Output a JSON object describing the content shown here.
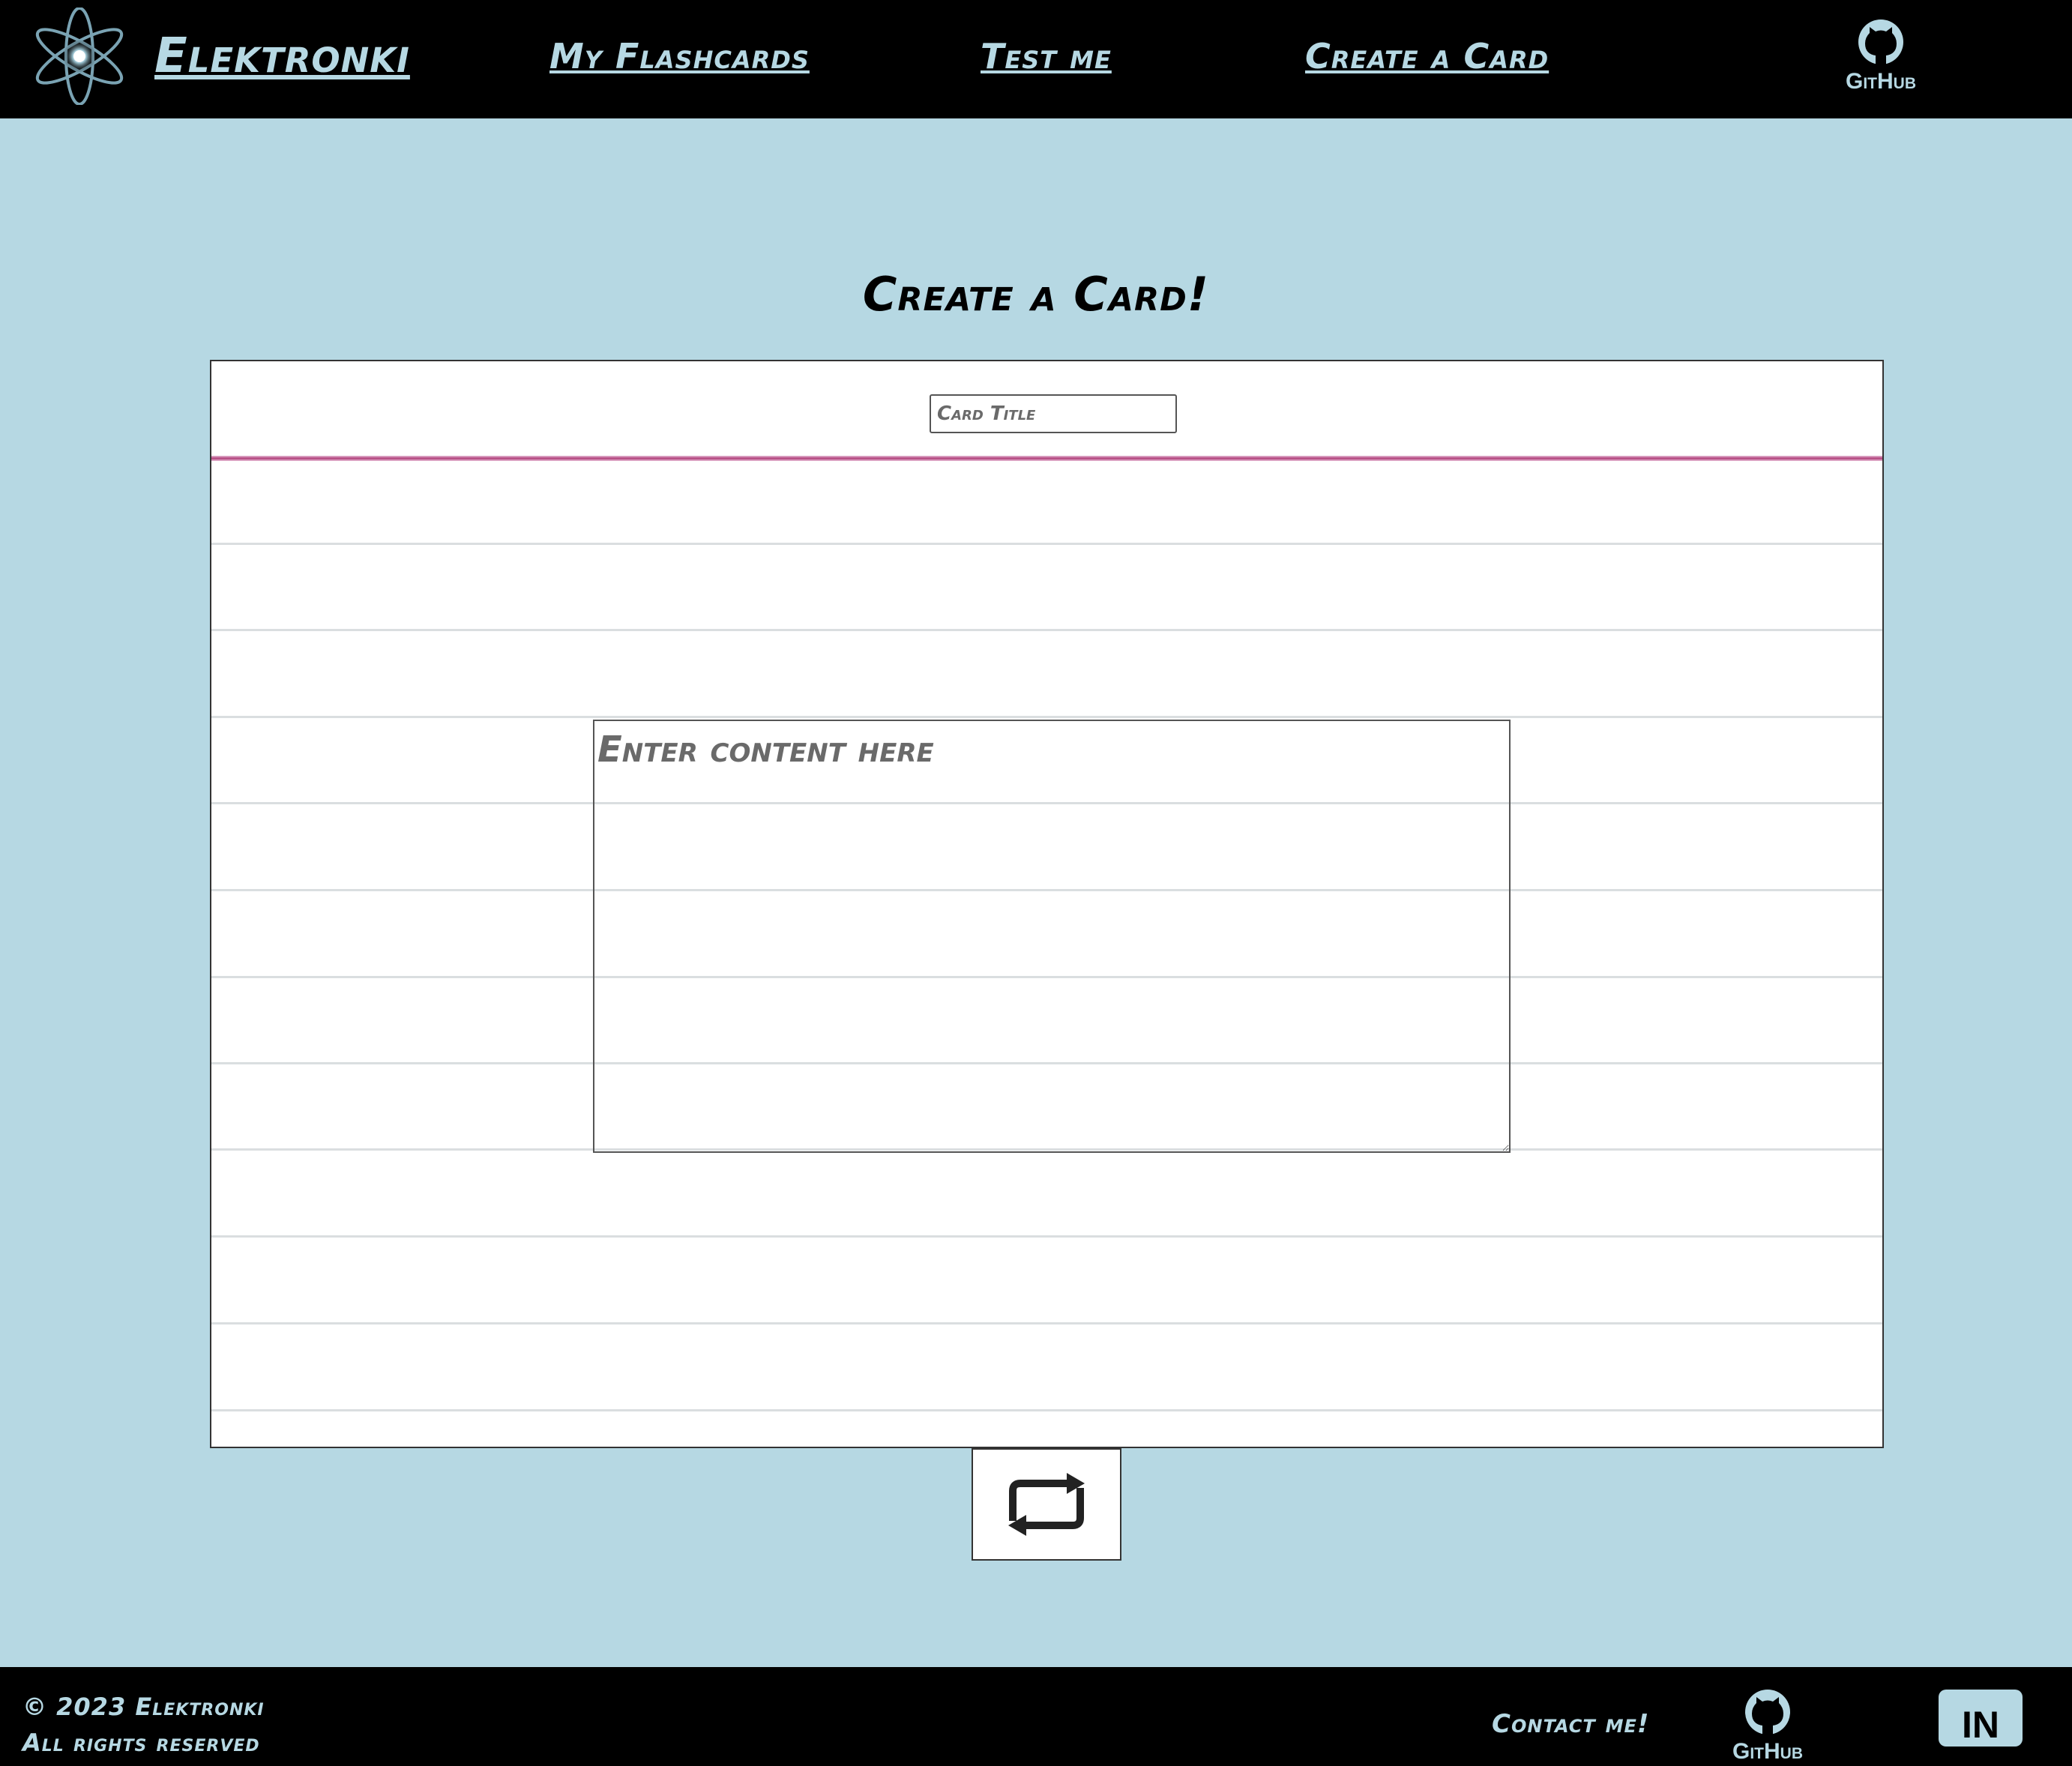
{
  "header": {
    "brand": "Elektronki",
    "nav": {
      "flashcards": "My Flashcards",
      "test": "Test me",
      "create": "Create a Card"
    },
    "github_label": "GitHub"
  },
  "main": {
    "title": "Create a Card!",
    "card": {
      "title_placeholder": "Card Title",
      "content_placeholder": "Enter content here"
    },
    "flip_icon": "repeat-icon"
  },
  "footer": {
    "copyright": "© 2023 Elektronki",
    "rights": "All rights reserved",
    "contact": "Contact me!",
    "github_label": "GitHub",
    "linkedin_label": "in"
  },
  "colors": {
    "accent": "#b6d8e3",
    "bar": "#000000",
    "margin_line": "#b0407a"
  }
}
